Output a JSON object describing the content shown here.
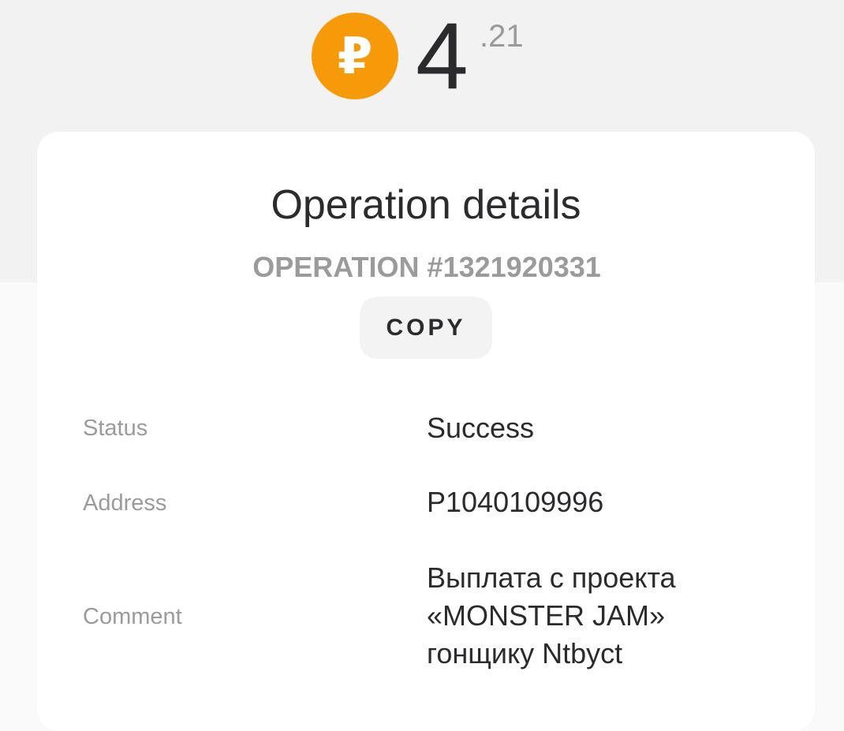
{
  "balance": {
    "currency_icon": "ruble-coin-icon",
    "currency_symbol": "₽",
    "integer": "4",
    "fraction": ".21",
    "coin_color": "#f79a0a"
  },
  "card": {
    "title": "Operation details",
    "operation_label": "OPERATION #1321920331",
    "copy_label": "COPY"
  },
  "details": {
    "status": {
      "label": "Status",
      "value": "Success"
    },
    "address": {
      "label": "Address",
      "value": "P1040109996"
    },
    "comment": {
      "label": "Comment",
      "value": "Выплата с проекта\n«MONSTER JAM»\nгонщику Ntbyct"
    }
  }
}
